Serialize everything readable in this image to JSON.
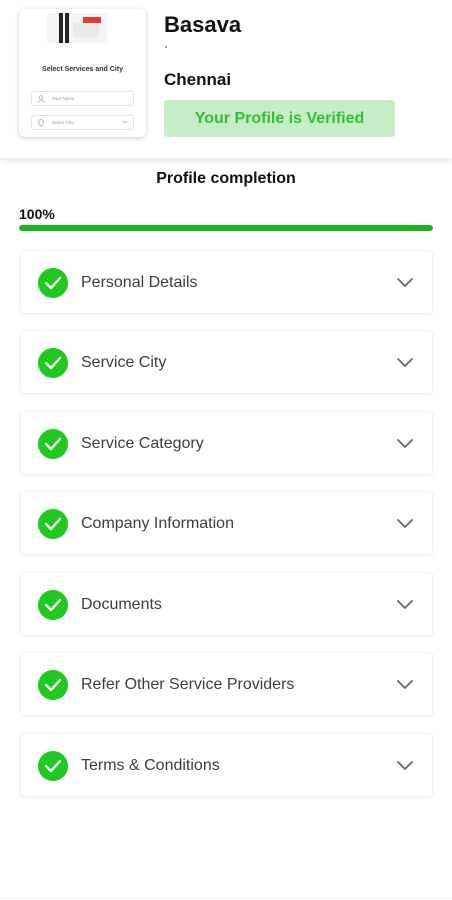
{
  "profile": {
    "name": "Basava",
    "subtext": ".",
    "city": "Chennai",
    "verified_label": "Your Profile is Verified"
  },
  "thumbnail": {
    "title": "Select Services and  City",
    "name_placeholder": "Your Name",
    "city_placeholder": "Select City"
  },
  "completion": {
    "title": "Profile completion",
    "percent_label": "100%",
    "progress": 1.0
  },
  "sections": [
    {
      "label": "Personal Details",
      "completed": true
    },
    {
      "label": "Service City",
      "completed": true
    },
    {
      "label": "Service Category",
      "completed": true
    },
    {
      "label": "Company Information",
      "completed": true
    },
    {
      "label": "Documents",
      "completed": true
    },
    {
      "label": "Refer Other Service Providers",
      "completed": true
    },
    {
      "label": "Terms & Conditions",
      "completed": true
    }
  ],
  "colors": {
    "accent_green": "#1fc91f",
    "verified_bg": "#c7edc6",
    "verified_text": "#2fbf3a",
    "progress_fill": "#1bb31e"
  },
  "icons": {
    "section_status": "check-circle-icon",
    "section_toggle": "chevron-down-icon"
  }
}
